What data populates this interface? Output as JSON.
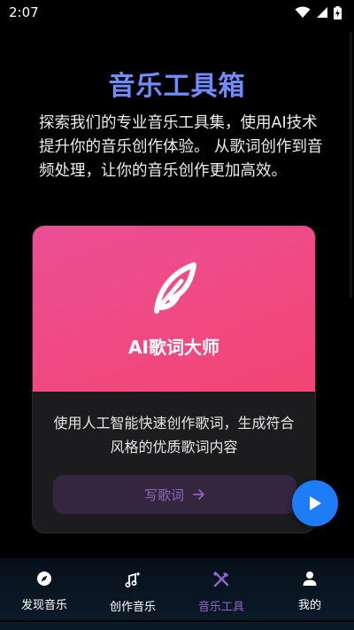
{
  "status_bar": {
    "time": "2:07"
  },
  "page": {
    "title": "音乐工具箱",
    "description": "探索我们的专业音乐工具集，使用AI技术提升你的音乐创作体验。 从歌词创作到音频处理，让你的音乐创作更加高效。"
  },
  "tool_card": {
    "icon": "feather-icon",
    "title": "AI歌词大师",
    "description": "使用人工智能快速创作歌词，生成符合风格的优质歌词内容",
    "button_label": "写歌词",
    "button_icon": "arrow-right-icon",
    "gradient_start": "#ec4f95",
    "gradient_end": "#f24573"
  },
  "fab": {
    "icon": "play-icon",
    "color": "#1f7cf7"
  },
  "bottom_nav": {
    "items": [
      {
        "label": "发现音乐",
        "icon": "compass-icon",
        "active": false
      },
      {
        "label": "创作音乐",
        "icon": "music-note-sparkle-icon",
        "active": false
      },
      {
        "label": "音乐工具",
        "icon": "tools-icon",
        "active": true
      },
      {
        "label": "我的",
        "icon": "person-icon",
        "active": false
      }
    ],
    "active_color": "#8f63ce"
  }
}
